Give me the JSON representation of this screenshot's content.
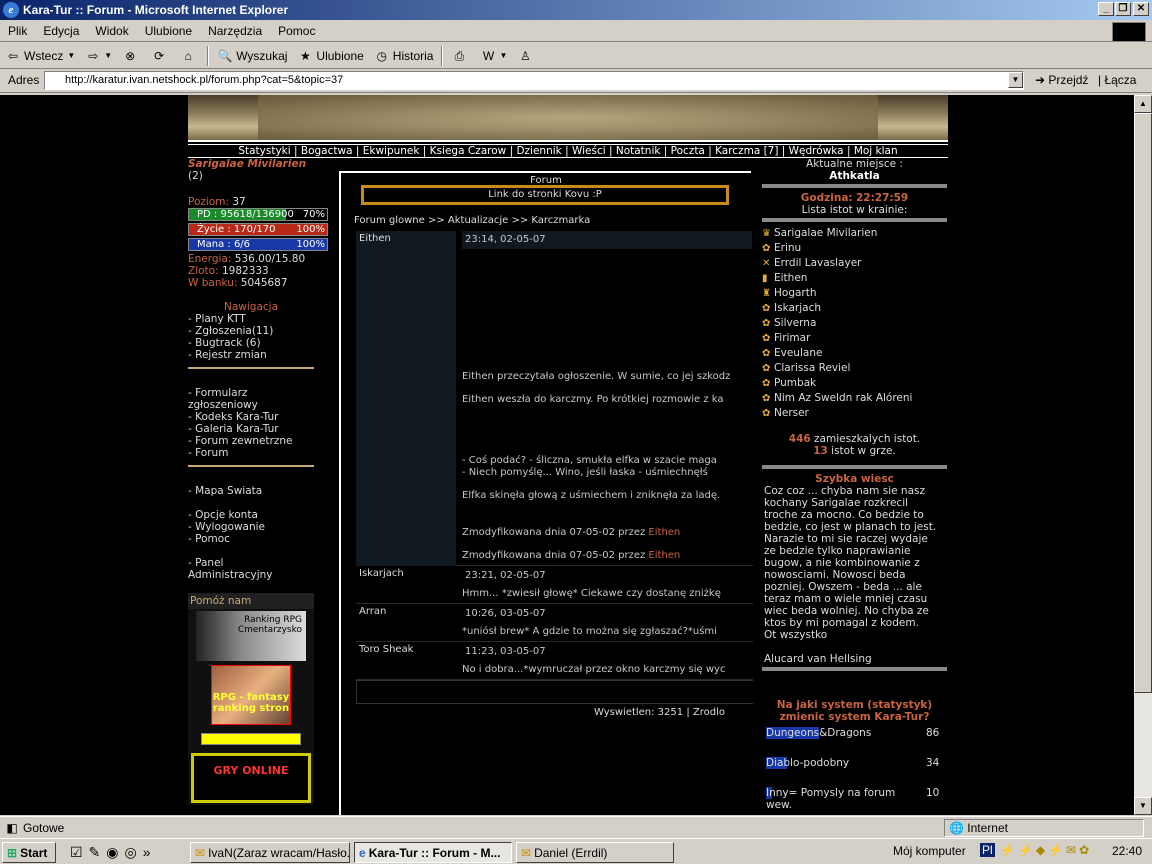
{
  "window": {
    "title": "Kara-Tur :: Forum - Microsoft Internet Explorer"
  },
  "menu": [
    "Plik",
    "Edycja",
    "Widok",
    "Ulubione",
    "Narzędzia",
    "Pomoc"
  ],
  "toolbar": {
    "back": "Wstecz",
    "search": "Wyszukaj",
    "favorites": "Ulubione",
    "history": "Historia"
  },
  "address": {
    "label": "Adres",
    "url": "http://karatur.ivan.netshock.pl/forum.php?cat=5&topic=37",
    "go": "Przejdź",
    "links": "Łącza"
  },
  "status": {
    "text": "Gotowe",
    "zone": "Internet"
  },
  "taskbar": {
    "start": "Start",
    "tasks": [
      "IvaN(Zaraz wracam/Hasło...",
      "Kara-Tur :: Forum - M...",
      "Daniel (Errdil)"
    ],
    "tray_label": "Mój komputer",
    "lang": "Pl",
    "time": "22:40"
  },
  "page": {
    "topnav": "Statystyki | Bogactwa | Ekwipunek | Ksiega Czarow | Dziennik | Wieści | Notatnik | Poczta | Karczma [7] | Wędrówka | Moj klan",
    "player": {
      "name": "Sarigalae Mivilarien",
      "count": "(2)"
    },
    "stats": {
      "level_label": "Poziom:",
      "level": "37",
      "pd": "PD : 95618/136900",
      "pd_pct": "70%",
      "pd_fill": 0.7,
      "life": "Życie : 170/170",
      "life_pct": "100%",
      "mana": "Mana : 6/6",
      "mana_pct": "100%",
      "energy_label": "Energia:",
      "energy": "536.00/15.80",
      "gold_label": "Zloto:",
      "gold": "1982333",
      "bank_label": "W banku:",
      "bank": "5045687"
    },
    "nav_title": "Nawigacja",
    "nav1": [
      "- Plany KTT",
      "- Zgłoszenia(11)",
      "- Bugtrack (6)",
      "- Rejestr zmian"
    ],
    "nav2": [
      "- Formularz",
      "zgłoszeniowy",
      "- Kodeks Kara-Tur",
      "- Galeria Kara-Tur",
      "- Forum zewnetrzne",
      "- Forum"
    ],
    "nav3": [
      "- Mapa Swiata"
    ],
    "nav4": [
      "- Opcje konta",
      "- Wylogowanie",
      "- Pomoc"
    ],
    "nav5": [
      "- Panel",
      "Administracyjny"
    ],
    "help": "Pomóż nam",
    "banners": {
      "ranking": "Ranking RPG",
      "cemetery": "Cmentarzysko",
      "rpg_fantasy": "RPG - fantasy ranking stron",
      "gry": "GRY ONLINE"
    },
    "forum": {
      "title": "Forum",
      "link": "Link do stronki Kovu :P",
      "breadcrumb": "Forum glowne >> Aktualizacje >> Karczmarka",
      "footer": "Wyswietlen: 3251 | Zrodlo",
      "posts": [
        {
          "author": "Eithen",
          "time": "23:14, 02-05-07",
          "lines": [
            "Eithen przeczytała ogłoszenie. W sumie, co jej szkodz",
            "Eithen weszła do karczmy. Po krótkiej rozmowie z ka",
            "- Coś podać? - śliczna, smukła elfka w szacie maga",
            "- Niech pomyślę... Wino, jeśli łaska - uśmiechnęłś",
            "Elfka skinęła głową z uśmiechem i zniknęła za ladę."
          ],
          "mod1": "Zmodyfikowana dnia 07-05-02 przez",
          "mod2": "Zmodyfikowana dnia 07-05-02 przez",
          "mod_by": "Eithen"
        },
        {
          "author": "Iskarjach",
          "time": "23:21, 02-05-07",
          "lines": [
            "Hmm... *zwiesił głowę* Ciekawe czy dostanę zniżkę"
          ]
        },
        {
          "author": "Arran",
          "time": "10:26, 03-05-07",
          "lines": [
            "*uniósł brew* A gdzie to można się zgłaszać?*uśmi"
          ]
        },
        {
          "author": "Toro Sheak",
          "time": "11:23, 03-05-07",
          "lines": [
            "No i dobra...*wymruczał przez okno karczmy się wyc"
          ]
        }
      ]
    },
    "right": {
      "loc_label": "Aktualne miejsce :",
      "loc": "Athkatla",
      "clock_label": "Godzina:",
      "clock": "22:27:59",
      "list_label": "Lista istot w krainie:",
      "users": [
        "Sarigalae Mivilarien",
        "Erinu",
        "Errdil Lavaslayer",
        "Eithen",
        "Hogarth",
        "Iskarjach",
        "Silverna",
        "Firimar",
        "Eveulane",
        "Clarissa Reviel",
        "Pumbak",
        "Nim Az Sweldn rak Alóreni",
        "Nerser"
      ],
      "inhab_count": "446",
      "inhab_label": "zamieszkalych istot.",
      "ingame_count": "13",
      "ingame_label": "istot w grze.",
      "news_title": "Szybka wiesc",
      "news_lines": [
        "Coz coz ... chyba nam sie nasz",
        "kochany Sarigalae rozkrecil",
        "troche za mocno. Co bedzie to",
        "bedzie, co jest w planach to jest.",
        "Narazie to mi sie raczej wydaje",
        "ze bedzie tylko naprawianie",
        "bugow, a nie kombinowanie z",
        "nowosciami. Nowosci beda",
        "pozniej. Owszem - beda ... ale",
        "teraz mam o wiele mniej czasu",
        "wiec beda wolniej. No chyba ze",
        "ktos by mi pomagal z kodem.",
        "Ot wszystko"
      ],
      "news_author": "Alucard van Hellsing",
      "poll_q1": "Na jaki system (statystyk)",
      "poll_q2": "zmienic system Kara-Tur?",
      "poll": [
        {
          "opt": "Dungeons&Dragons",
          "votes": "86",
          "share": 0.66
        },
        {
          "opt": "Diablo-podobny",
          "votes": "34",
          "share": 0.26
        },
        {
          "opt": "Inny= Pomysly na forum wew.",
          "votes": "10",
          "share": 0.08
        }
      ]
    }
  }
}
